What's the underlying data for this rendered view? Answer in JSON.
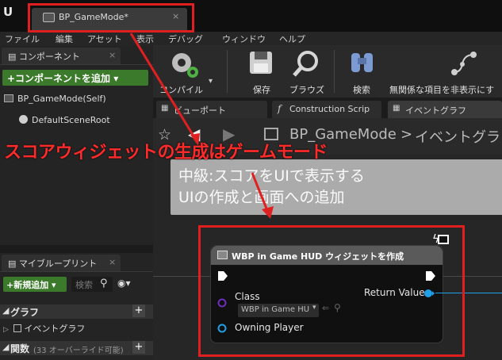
{
  "app": {
    "logo": "U",
    "tab_title": "BP_GameMode*",
    "tab_close": "×"
  },
  "menu": [
    "ファイル",
    "編集",
    "アセット",
    "表示",
    "デバッグ",
    "ウィンドウ",
    "ヘルプ"
  ],
  "components_panel": {
    "tab_label": "コンポーネント",
    "add_button": "+コンポーネントを追加 ▾",
    "items": [
      "BP_GameMode(Self)",
      "DefaultSceneRoot"
    ]
  },
  "blueprint_panel": {
    "tab_label": "マイブループリント",
    "new_button": "+新規追加 ▾",
    "search_placeholder": "検索",
    "graph_section": "グラフ",
    "event_graph": "イベントグラフ",
    "functions_section": "関数",
    "functions_count": "(33 オーバーライド可能)"
  },
  "toolbar": {
    "compile": "コンパイル",
    "save": "保存",
    "browse": "ブラウズ",
    "find": "検索",
    "hide_unrelated": "無関係な項目を非表示にす"
  },
  "subtabs": [
    "ビューポート",
    "Construction Scrip",
    "イベントグラフ"
  ],
  "breadcrumb": {
    "root": "BP_GameMode",
    "separator": ">",
    "current": "イベントグラフ"
  },
  "comment": {
    "line1": "中級:スコアをUIで表示する",
    "line2": "UIの作成と画面への追加"
  },
  "node": {
    "title": "WBP in Game HUD ウィジェットを作成",
    "class_label": "Class",
    "class_value": "WBP in Game HU",
    "owning_player": "Owning Player",
    "return_value": "Return Value"
  },
  "annotation": "スコアウィジェットの生成はゲームモード",
  "colors": {
    "highlight": "#e02020",
    "add_button": "#3b7a2a",
    "class_pin": "#6a2fbf",
    "object_pin": "#1fa0e8",
    "comment_bg": "#ababab"
  }
}
